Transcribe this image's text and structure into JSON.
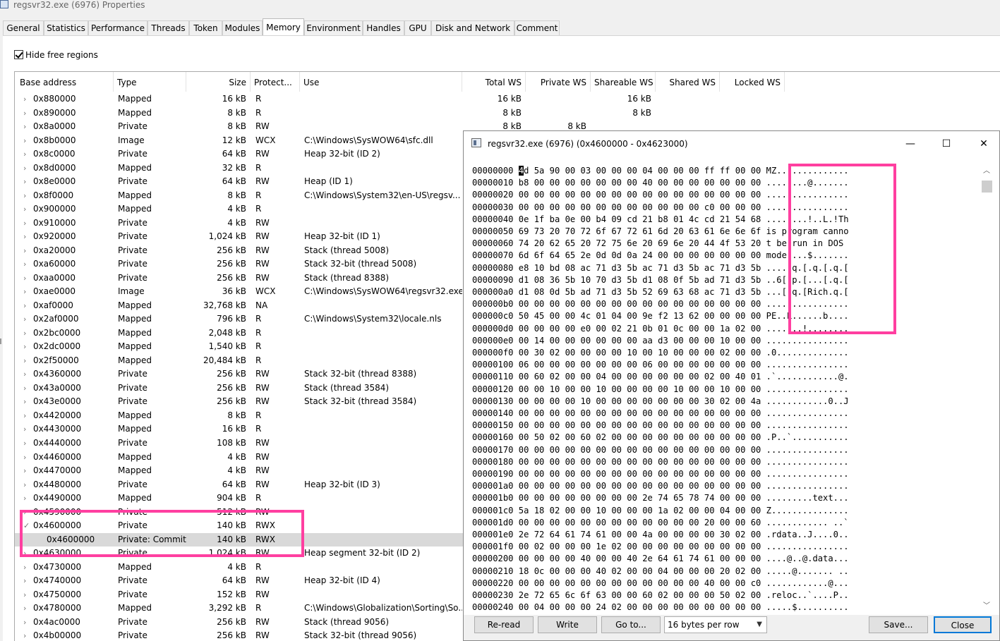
{
  "window": {
    "title": "regsvr32.exe (6976) Properties"
  },
  "tabs": [
    {
      "label": "General"
    },
    {
      "label": "Statistics"
    },
    {
      "label": "Performance"
    },
    {
      "label": "Threads"
    },
    {
      "label": "Token"
    },
    {
      "label": "Modules"
    },
    {
      "label": "Memory",
      "active": true
    },
    {
      "label": "Environment"
    },
    {
      "label": "Handles"
    },
    {
      "label": "GPU"
    },
    {
      "label": "Disk and Network"
    },
    {
      "label": "Comment"
    }
  ],
  "options": {
    "hide_free_regions_label": "Hide free regions",
    "hide_free_regions_checked": true
  },
  "columns": {
    "base": "Base address",
    "type": "Type",
    "size": "Size",
    "protect": "Protect...",
    "use": "Use",
    "total_ws": "Total WS",
    "private_ws": "Private WS",
    "shareable_ws": "Shareable WS",
    "shared_ws": "Shared WS",
    "locked_ws": "Locked WS"
  },
  "rows": [
    {
      "base": "0x880000",
      "type": "Mapped",
      "size": "16 kB",
      "protect": "R",
      "use": "",
      "total_ws": "16 kB",
      "private_ws": "",
      "shareable_ws": "16 kB"
    },
    {
      "base": "0x890000",
      "type": "Mapped",
      "size": "8 kB",
      "protect": "R",
      "use": "",
      "total_ws": "8 kB",
      "private_ws": "",
      "shareable_ws": "8 kB"
    },
    {
      "base": "0x8a0000",
      "type": "Private",
      "size": "8 kB",
      "protect": "RW",
      "use": "",
      "total_ws": "8 kB",
      "private_ws": "8 kB",
      "shareable_ws": ""
    },
    {
      "base": "0x8b0000",
      "type": "Image",
      "size": "12 kB",
      "protect": "WCX",
      "use": "C:\\Windows\\SysWOW64\\sfc.dll"
    },
    {
      "base": "0x8c0000",
      "type": "Private",
      "size": "64 kB",
      "protect": "RW",
      "use": "Heap 32-bit (ID 2)"
    },
    {
      "base": "0x8d0000",
      "type": "Mapped",
      "size": "32 kB",
      "protect": "R",
      "use": ""
    },
    {
      "base": "0x8e0000",
      "type": "Private",
      "size": "64 kB",
      "protect": "RW",
      "use": "Heap (ID 1)"
    },
    {
      "base": "0x8f0000",
      "type": "Mapped",
      "size": "8 kB",
      "protect": "R",
      "use": "C:\\Windows\\System32\\en-US\\regsv..."
    },
    {
      "base": "0x900000",
      "type": "Mapped",
      "size": "4 kB",
      "protect": "R",
      "use": ""
    },
    {
      "base": "0x910000",
      "type": "Private",
      "size": "4 kB",
      "protect": "RW",
      "use": ""
    },
    {
      "base": "0x920000",
      "type": "Private",
      "size": "1,024 kB",
      "protect": "RW",
      "use": "Heap 32-bit (ID 1)"
    },
    {
      "base": "0xa20000",
      "type": "Private",
      "size": "256 kB",
      "protect": "RW",
      "use": "Stack (thread 5008)"
    },
    {
      "base": "0xa60000",
      "type": "Private",
      "size": "256 kB",
      "protect": "RW",
      "use": "Stack 32-bit (thread 5008)"
    },
    {
      "base": "0xaa0000",
      "type": "Private",
      "size": "256 kB",
      "protect": "RW",
      "use": "Stack (thread 8388)"
    },
    {
      "base": "0xae0000",
      "type": "Image",
      "size": "36 kB",
      "protect": "WCX",
      "use": "C:\\Windows\\SysWOW64\\regsvr32.exe"
    },
    {
      "base": "0xaf0000",
      "type": "Mapped",
      "size": "32,768 kB",
      "protect": "NA",
      "use": ""
    },
    {
      "base": "0x2af0000",
      "type": "Mapped",
      "size": "796 kB",
      "protect": "R",
      "use": "C:\\Windows\\System32\\locale.nls"
    },
    {
      "base": "0x2bc0000",
      "type": "Mapped",
      "size": "2,048 kB",
      "protect": "R",
      "use": ""
    },
    {
      "base": "0x2dc0000",
      "type": "Mapped",
      "size": "1,540 kB",
      "protect": "R",
      "use": ""
    },
    {
      "base": "0x2f50000",
      "type": "Mapped",
      "size": "20,484 kB",
      "protect": "R",
      "use": ""
    },
    {
      "base": "0x4360000",
      "type": "Private",
      "size": "256 kB",
      "protect": "RW",
      "use": "Stack 32-bit (thread 8388)"
    },
    {
      "base": "0x43a0000",
      "type": "Private",
      "size": "256 kB",
      "protect": "RW",
      "use": "Stack (thread 3584)"
    },
    {
      "base": "0x43e0000",
      "type": "Private",
      "size": "256 kB",
      "protect": "RW",
      "use": "Stack 32-bit (thread 3584)"
    },
    {
      "base": "0x4420000",
      "type": "Mapped",
      "size": "8 kB",
      "protect": "R",
      "use": ""
    },
    {
      "base": "0x4430000",
      "type": "Mapped",
      "size": "16 kB",
      "protect": "R",
      "use": ""
    },
    {
      "base": "0x4440000",
      "type": "Private",
      "size": "108 kB",
      "protect": "RW",
      "use": ""
    },
    {
      "base": "0x4460000",
      "type": "Mapped",
      "size": "4 kB",
      "protect": "RW",
      "use": ""
    },
    {
      "base": "0x4470000",
      "type": "Mapped",
      "size": "4 kB",
      "protect": "RW",
      "use": ""
    },
    {
      "base": "0x4480000",
      "type": "Private",
      "size": "64 kB",
      "protect": "RW",
      "use": "Heap 32-bit (ID 3)"
    },
    {
      "base": "0x4490000",
      "type": "Mapped",
      "size": "904 kB",
      "protect": "R",
      "use": ""
    },
    {
      "base": "0x4590000",
      "type": "Private",
      "size": "512 kB",
      "protect": "RW",
      "use": ""
    },
    {
      "base": "0x4600000",
      "type": "Private",
      "size": "140 kB",
      "protect": "RWX",
      "use": "",
      "expanded": true
    },
    {
      "base": "0x4600000",
      "type": "Private: Commit",
      "size": "140 kB",
      "protect": "RWX",
      "use": "",
      "child": true,
      "selected": true
    },
    {
      "base": "0x4630000",
      "type": "Private",
      "size": "1,024 kB",
      "protect": "RW",
      "use": "Heap segment 32-bit (ID 2)"
    },
    {
      "base": "0x4730000",
      "type": "Mapped",
      "size": "4 kB",
      "protect": "R",
      "use": ""
    },
    {
      "base": "0x4740000",
      "type": "Private",
      "size": "64 kB",
      "protect": "RW",
      "use": "Heap 32-bit (ID 4)"
    },
    {
      "base": "0x4750000",
      "type": "Private",
      "size": "152 kB",
      "protect": "RW",
      "use": ""
    },
    {
      "base": "0x4780000",
      "type": "Mapped",
      "size": "3,292 kB",
      "protect": "R",
      "use": "C:\\Windows\\Globalization\\Sorting\\So..."
    },
    {
      "base": "0x4ac0000",
      "type": "Private",
      "size": "256 kB",
      "protect": "RW",
      "use": "Stack (thread 9056)"
    },
    {
      "base": "0x4b00000",
      "type": "Private",
      "size": "256 kB",
      "protect": "RW",
      "use": "Stack 32-bit (thread 9056)"
    }
  ],
  "hex_window": {
    "title": "regsvr32.exe (6976) (0x4600000 - 0x4623000)",
    "minimize": "—",
    "maximize": "☐",
    "close": "✕",
    "lines": [
      {
        "offset": "00000000",
        "hex": "4d 5a 90 00 03 00 00 00 04 00 00 00 ff ff 00 00",
        "ascii": "MZ.............."
      },
      {
        "offset": "00000010",
        "hex": "b8 00 00 00 00 00 00 00 40 00 00 00 00 00 00 00",
        "ascii": "........@......."
      },
      {
        "offset": "00000020",
        "hex": "00 00 00 00 00 00 00 00 00 00 00 00 00 00 00 00",
        "ascii": "................"
      },
      {
        "offset": "00000030",
        "hex": "00 00 00 00 00 00 00 00 00 00 00 00 c0 00 00 00",
        "ascii": "................"
      },
      {
        "offset": "00000040",
        "hex": "0e 1f ba 0e 00 b4 09 cd 21 b8 01 4c cd 21 54 68",
        "ascii": "........!..L.!Th"
      },
      {
        "offset": "00000050",
        "hex": "69 73 20 70 72 6f 67 72 61 6d 20 63 61 6e 6e 6f",
        "ascii": "is program canno"
      },
      {
        "offset": "00000060",
        "hex": "74 20 62 65 20 72 75 6e 20 69 6e 20 44 4f 53 20",
        "ascii": "t be run in DOS "
      },
      {
        "offset": "00000070",
        "hex": "6d 6f 64 65 2e 0d 0d 0a 24 00 00 00 00 00 00 00",
        "ascii": "mode....$......."
      },
      {
        "offset": "00000080",
        "hex": "e8 10 bd 08 ac 71 d3 5b ac 71 d3 5b ac 71 d3 5b",
        "ascii": ".....q.[.q.[.q.["
      },
      {
        "offset": "00000090",
        "hex": "d1 08 36 5b 10 70 d3 5b d1 08 0f 5b ad 71 d3 5b",
        "ascii": "..6[.p.[...[.q.["
      },
      {
        "offset": "000000a0",
        "hex": "d1 08 0d 5b ad 71 d3 5b 52 69 63 68 ac 71 d3 5b",
        "ascii": "...[.q.[Rich.q.["
      },
      {
        "offset": "000000b0",
        "hex": "00 00 00 00 00 00 00 00 00 00 00 00 00 00 00 00",
        "ascii": "................"
      },
      {
        "offset": "000000c0",
        "hex": "50 45 00 00 4c 01 04 00 9e f2 13 62 00 00 00 00",
        "ascii": "PE..L......b...."
      },
      {
        "offset": "000000d0",
        "hex": "00 00 00 00 e0 00 02 21 0b 01 0c 00 00 1a 02 00",
        "ascii": ".......!........"
      },
      {
        "offset": "000000e0",
        "hex": "00 14 00 00 00 00 00 00 aa d3 00 00 00 10 00 00",
        "ascii": "................"
      },
      {
        "offset": "000000f0",
        "hex": "00 30 02 00 00 00 00 10 00 10 00 00 00 02 00 00",
        "ascii": ".0.............."
      },
      {
        "offset": "00000100",
        "hex": "06 00 00 00 00 00 00 00 06 00 00 00 00 00 00 00",
        "ascii": "................"
      },
      {
        "offset": "00000110",
        "hex": "00 60 02 00 00 04 00 00 00 00 00 00 02 00 40 01",
        "ascii": ".`............@."
      },
      {
        "offset": "00000120",
        "hex": "00 00 10 00 00 10 00 00 00 00 10 00 00 10 00 00",
        "ascii": "................"
      },
      {
        "offset": "00000130",
        "hex": "00 00 00 00 10 00 00 00 00 00 00 00 30 02 00 4a",
        "ascii": "............0..J"
      },
      {
        "offset": "00000140",
        "hex": "00 00 00 00 00 00 00 00 00 00 00 00 00 00 00 00",
        "ascii": "................"
      },
      {
        "offset": "00000150",
        "hex": "00 00 00 00 00 00 00 00 00 00 00 00 00 00 00 00",
        "ascii": "................"
      },
      {
        "offset": "00000160",
        "hex": "00 50 02 00 60 02 00 00 00 00 00 00 00 00 00 00",
        "ascii": ".P..`..........."
      },
      {
        "offset": "00000170",
        "hex": "00 00 00 00 00 00 00 00 00 00 00 00 00 00 00 00",
        "ascii": "................"
      },
      {
        "offset": "00000180",
        "hex": "00 00 00 00 00 00 00 00 00 00 00 00 00 00 00 00",
        "ascii": "................"
      },
      {
        "offset": "00000190",
        "hex": "00 00 00 00 00 00 00 00 00 00 00 00 00 00 00 00",
        "ascii": "................"
      },
      {
        "offset": "000001a0",
        "hex": "00 00 00 00 00 00 00 00 00 00 00 00 00 00 00 00",
        "ascii": "................"
      },
      {
        "offset": "000001b0",
        "hex": "00 00 00 00 00 00 00 00 2e 74 65 78 74 00 00 00",
        "ascii": ".........text..."
      },
      {
        "offset": "000001c0",
        "hex": "5a 18 02 00 00 10 00 00 00 1a 02 00 00 04 00 00",
        "ascii": "Z..............."
      },
      {
        "offset": "000001d0",
        "hex": "00 00 00 00 00 00 00 00 00 00 00 00 20 00 00 60",
        "ascii": "............ ..`"
      },
      {
        "offset": "000001e0",
        "hex": "2e 72 64 61 74 61 00 00 4a 00 00 00 00 30 02 00",
        "ascii": ".rdata..J....0.."
      },
      {
        "offset": "000001f0",
        "hex": "00 02 00 00 00 1e 02 00 00 00 00 00 00 00 00 00",
        "ascii": "................"
      },
      {
        "offset": "00000200",
        "hex": "00 00 00 00 40 00 00 40 2e 64 61 74 61 00 00 00",
        "ascii": "....@..@.data..."
      },
      {
        "offset": "00000210",
        "hex": "18 0c 00 00 00 40 02 00 00 04 00 00 00 20 02 00",
        "ascii": ".....@....... .."
      },
      {
        "offset": "00000220",
        "hex": "00 00 00 00 00 00 00 00 00 00 00 00 40 00 00 c0",
        "ascii": "............@..."
      },
      {
        "offset": "00000230",
        "hex": "2e 72 65 6c 6f 63 00 00 60 02 00 00 00 50 02 00",
        "ascii": ".reloc..`....P.."
      },
      {
        "offset": "00000240",
        "hex": "00 04 00 00 00 24 02 00 00 00 00 00 00 00 00 00",
        "ascii": ".....$.........."
      }
    ],
    "buttons": {
      "reread": "Re-read",
      "write": "Write",
      "goto": "Go to...",
      "bytes_per_row": "16 bytes per row",
      "save": "Save...",
      "close": "Close"
    }
  },
  "colors": {
    "highlight": "#ff3fa0",
    "selection": "#d9d9d9",
    "accent": "#0078d7"
  }
}
